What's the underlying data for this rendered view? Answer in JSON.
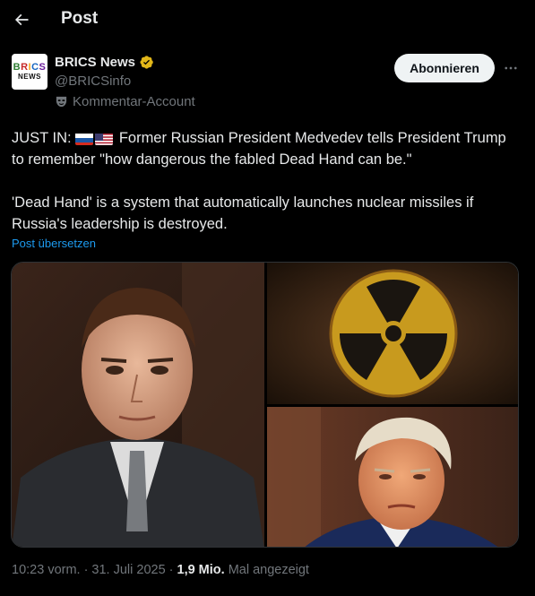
{
  "header": {
    "title": "Post"
  },
  "author": {
    "avatar_line1": [
      "B",
      "R",
      "I",
      "C",
      "S"
    ],
    "avatar_line2": "NEWS",
    "display_name": "BRICS News",
    "handle": "@BRICSinfo",
    "account_label": "Kommentar-Account",
    "follow_label": "Abonnieren"
  },
  "tweet": {
    "line1_prefix": "JUST IN:",
    "line1_text": "Former Russian President Medvedev tells President Trump to remember \"how dangerous the fabled Dead Hand can be.\"",
    "line2_text": "'Dead Hand' is a system that automatically launches nuclear missiles if Russia's leadership is destroyed.",
    "translate_label": "Post übersetzen"
  },
  "meta": {
    "time": "10:23 vorm.",
    "sep1": "·",
    "date": "31. Juli 2025",
    "sep2": "·",
    "views_num": "1,9 Mio.",
    "views_label": "Mal angezeigt"
  },
  "colors": {
    "background": "#000000",
    "text": "#e7e9ea",
    "muted": "#71767b",
    "link": "#1d9bf0",
    "verified": "#e2b719"
  }
}
